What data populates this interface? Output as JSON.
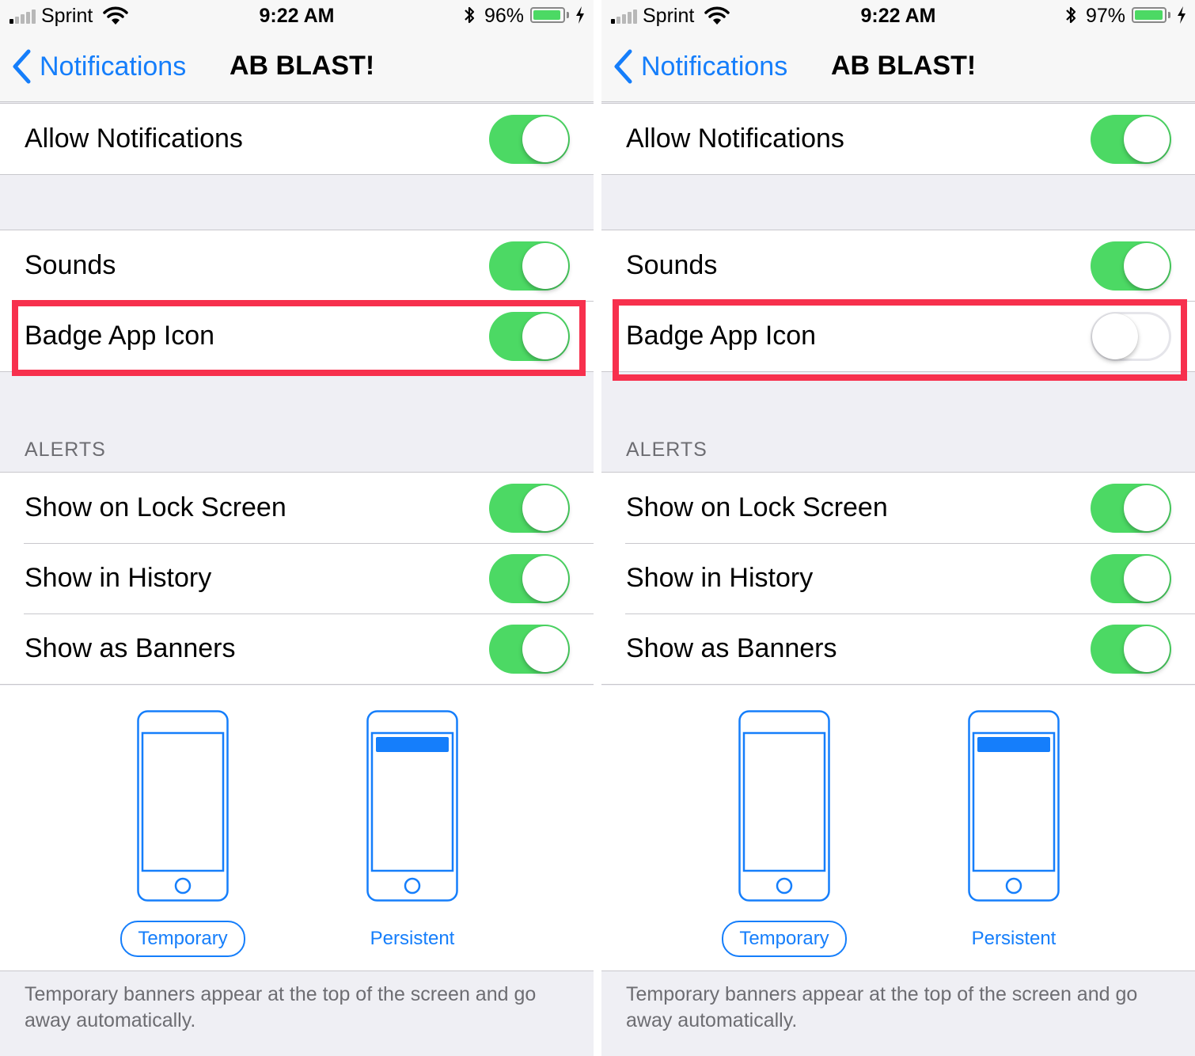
{
  "left": {
    "status": {
      "carrier": "Sprint",
      "time": "9:22 AM",
      "battery": "96%",
      "battery_level": 0.96
    },
    "nav": {
      "back_label": "Notifications",
      "title": "AB BLAST!"
    },
    "rows": {
      "allow_notifications": {
        "label": "Allow Notifications",
        "on": true
      },
      "sounds": {
        "label": "Sounds",
        "on": true
      },
      "badge_app_icon": {
        "label": "Badge App Icon",
        "on": true
      }
    },
    "alerts_header": "ALERTS",
    "alerts": [
      {
        "label": "Show on Lock Screen",
        "on": true
      },
      {
        "label": "Show in History",
        "on": true
      },
      {
        "label": "Show as Banners",
        "on": true
      }
    ],
    "banner_styles": [
      {
        "label": "Temporary",
        "selected": true
      },
      {
        "label": "Persistent",
        "selected": false
      }
    ],
    "footer": "Temporary banners appear at the top of the screen and go away automatically."
  },
  "right": {
    "status": {
      "carrier": "Sprint",
      "time": "9:22 AM",
      "battery": "97%",
      "battery_level": 0.97
    },
    "nav": {
      "back_label": "Notifications",
      "title": "AB BLAST!"
    },
    "rows": {
      "allow_notifications": {
        "label": "Allow Notifications",
        "on": true
      },
      "sounds": {
        "label": "Sounds",
        "on": true
      },
      "badge_app_icon": {
        "label": "Badge App Icon",
        "on": false
      }
    },
    "alerts_header": "ALERTS",
    "alerts": [
      {
        "label": "Show on Lock Screen",
        "on": true
      },
      {
        "label": "Show in History",
        "on": true
      },
      {
        "label": "Show as Banners",
        "on": true
      }
    ],
    "banner_styles": [
      {
        "label": "Temporary",
        "selected": true
      },
      {
        "label": "Persistent",
        "selected": false
      }
    ],
    "footer": "Temporary banners appear at the top of the screen and go away automatically."
  },
  "colors": {
    "accent": "#157efb",
    "toggle_on": "#4cd964",
    "highlight": "#f7304d",
    "grouped_bg": "#efeff4"
  },
  "icons": [
    "signal-icon",
    "wifi-icon",
    "bluetooth-icon",
    "battery-icon",
    "charging-icon",
    "back-chevron-icon",
    "phone-temporary-icon",
    "phone-persistent-icon"
  ]
}
